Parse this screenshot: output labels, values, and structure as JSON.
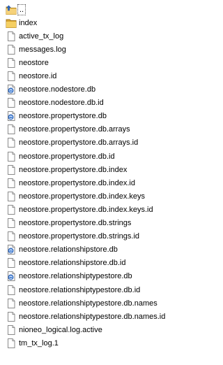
{
  "files": [
    {
      "name": "..",
      "type": "parent"
    },
    {
      "name": "index",
      "type": "folder"
    },
    {
      "name": "active_tx_log",
      "type": "file"
    },
    {
      "name": "messages.log",
      "type": "file"
    },
    {
      "name": "neostore",
      "type": "file"
    },
    {
      "name": "neostore.id",
      "type": "file"
    },
    {
      "name": "neostore.nodestore.db",
      "type": "db"
    },
    {
      "name": "neostore.nodestore.db.id",
      "type": "file"
    },
    {
      "name": "neostore.propertystore.db",
      "type": "db"
    },
    {
      "name": "neostore.propertystore.db.arrays",
      "type": "file"
    },
    {
      "name": "neostore.propertystore.db.arrays.id",
      "type": "file"
    },
    {
      "name": "neostore.propertystore.db.id",
      "type": "file"
    },
    {
      "name": "neostore.propertystore.db.index",
      "type": "file"
    },
    {
      "name": "neostore.propertystore.db.index.id",
      "type": "file"
    },
    {
      "name": "neostore.propertystore.db.index.keys",
      "type": "file"
    },
    {
      "name": "neostore.propertystore.db.index.keys.id",
      "type": "file"
    },
    {
      "name": "neostore.propertystore.db.strings",
      "type": "file"
    },
    {
      "name": "neostore.propertystore.db.strings.id",
      "type": "file"
    },
    {
      "name": "neostore.relationshipstore.db",
      "type": "db"
    },
    {
      "name": "neostore.relationshipstore.db.id",
      "type": "file"
    },
    {
      "name": "neostore.relationshiptypestore.db",
      "type": "db"
    },
    {
      "name": "neostore.relationshiptypestore.db.id",
      "type": "file"
    },
    {
      "name": "neostore.relationshiptypestore.db.names",
      "type": "file"
    },
    {
      "name": "neostore.relationshiptypestore.db.names.id",
      "type": "file"
    },
    {
      "name": "nioneo_logical.log.active",
      "type": "file"
    },
    {
      "name": "tm_tx_log.1",
      "type": "file"
    }
  ]
}
